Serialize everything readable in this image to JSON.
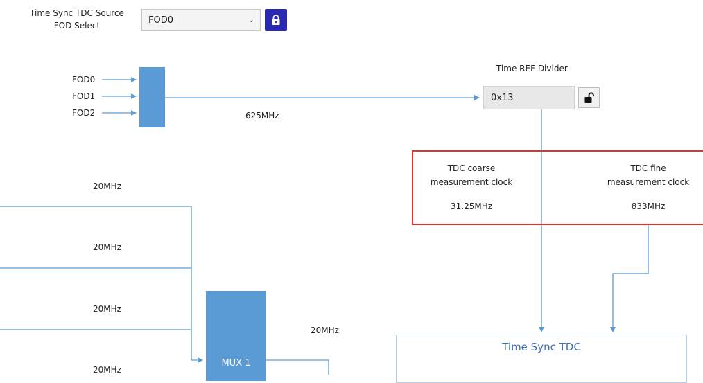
{
  "controls": {
    "tdc_source_label_line1": "Time Sync TDC Source",
    "tdc_source_label_line2": "FOD Select",
    "tdc_source_value": "FOD0"
  },
  "fod_mux": {
    "inputs": [
      "FOD0",
      "FOD1",
      "FOD2"
    ],
    "output_freq": "625MHz"
  },
  "time_ref_divider": {
    "title": "Time REF Divider",
    "value": "0x13"
  },
  "tdc_clocks": {
    "coarse_line1": "TDC coarse",
    "coarse_line2": "measurement clock",
    "coarse_value": "31.25MHz",
    "fine_line1": "TDC fine",
    "fine_line2": "measurement clock",
    "fine_value": "833MHz"
  },
  "mux1": {
    "inputs": [
      "20MHz",
      "20MHz",
      "20MHz",
      "20MHz"
    ],
    "label": "MUX 1",
    "output_freq": "20MHz"
  },
  "time_sync_tdc": {
    "title": "Time Sync TDC"
  },
  "colors": {
    "line": "#5b9bd5",
    "block": "#5b9bd5",
    "highlight": "#e03030",
    "lock_button": "#2a2ab0"
  },
  "icons": {
    "select_chevron": "chevron-down-icon",
    "source_lock": "lock-icon",
    "divider_lock": "unlock-icon"
  }
}
